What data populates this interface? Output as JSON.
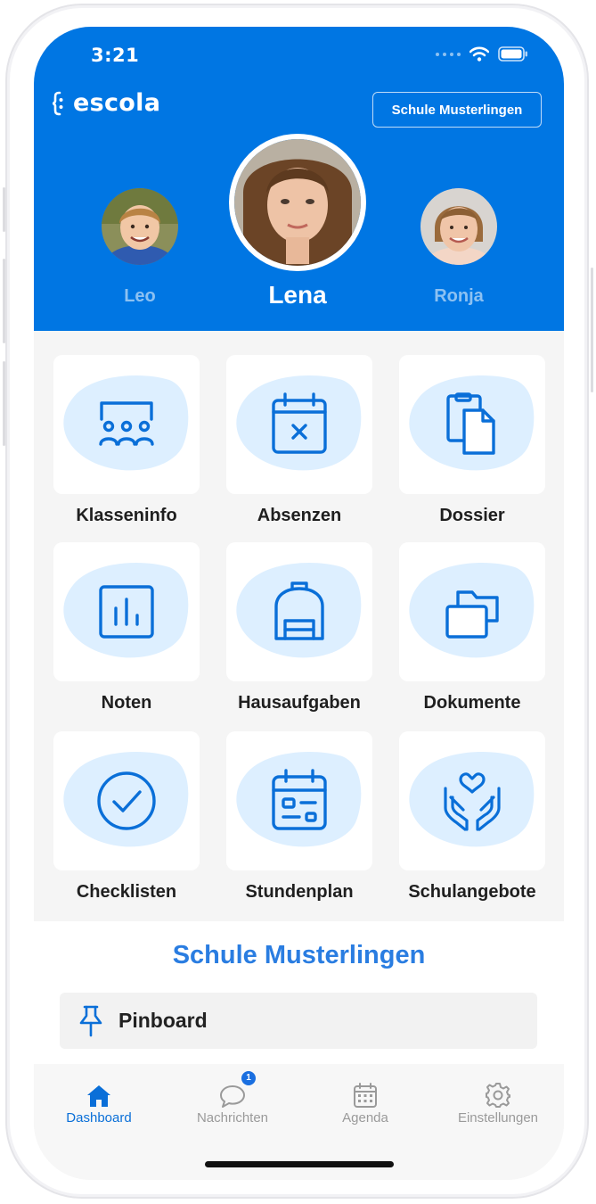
{
  "status_bar": {
    "time": "3:21"
  },
  "app": {
    "logo_text": "escola",
    "school_button": "Schule Musterlingen"
  },
  "profiles": {
    "selected": {
      "name": "Lena"
    },
    "left": {
      "name": "Leo"
    },
    "right": {
      "name": "Ronja"
    }
  },
  "tiles": [
    {
      "label": "Klasseninfo",
      "icon": "group-icon"
    },
    {
      "label": "Absenzen",
      "icon": "calendar-x-icon"
    },
    {
      "label": "Dossier",
      "icon": "documents-copy-icon"
    },
    {
      "label": "Noten",
      "icon": "bar-chart-icon"
    },
    {
      "label": "Hausaufgaben",
      "icon": "backpack-icon"
    },
    {
      "label": "Dokumente",
      "icon": "folders-icon"
    },
    {
      "label": "Checklisten",
      "icon": "check-circle-icon"
    },
    {
      "label": "Stundenplan",
      "icon": "timetable-icon"
    },
    {
      "label": "Schulangebote",
      "icon": "hands-heart-icon"
    }
  ],
  "school_section": {
    "title": "Schule Musterlingen",
    "pinboard_label": "Pinboard"
  },
  "tabbar": {
    "items": [
      {
        "label": "Dashboard",
        "icon": "home-icon",
        "active": true
      },
      {
        "label": "Nachrichten",
        "icon": "chat-icon",
        "badge": "1"
      },
      {
        "label": "Agenda",
        "icon": "calendar-icon"
      },
      {
        "label": "Einstellungen",
        "icon": "gear-icon"
      }
    ]
  },
  "colors": {
    "primary": "#0076e3",
    "accent_text": "#2a7de1",
    "icon_blue": "#0a6fd8",
    "blob": "#ddefff"
  }
}
